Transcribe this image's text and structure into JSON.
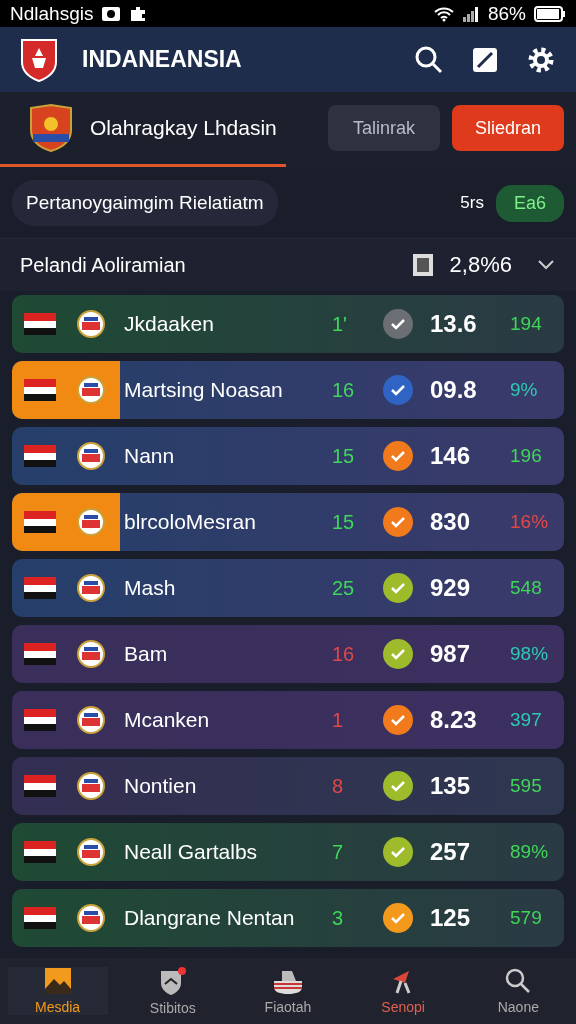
{
  "status_bar": {
    "carrier": "Ndlahsgis",
    "battery": "86%"
  },
  "header": {
    "title": "INDANEANSIA"
  },
  "team_bar": {
    "name": "Olahragkay Lhdasin",
    "buttons": [
      {
        "label": "Talinrak",
        "selected": false
      },
      {
        "label": "Sliedran",
        "selected": true
      }
    ]
  },
  "filter": {
    "label": "Pertanoygaimgim Rielatiatm",
    "count": "5rs",
    "badge": "Ea6"
  },
  "section": {
    "title": "Pelandi Aoliramian",
    "value": "2,8%6",
    "expanded": false
  },
  "rows": [
    {
      "name": "Jkdaaken",
      "kind": "green",
      "highlighted": false,
      "count": {
        "text": "1'",
        "color": "#3fd65a"
      },
      "check": {
        "color": "#6b6e73"
      },
      "score": "13.6",
      "percent": {
        "text": "194",
        "color": "#3fd65a"
      }
    },
    {
      "name": "Martsing Noasan",
      "kind": "blue",
      "highlighted": true,
      "count": {
        "text": "16",
        "color": "#3fd65a"
      },
      "check": {
        "color": "#2f64c4"
      },
      "score": "09.8",
      "percent": {
        "text": "9%",
        "color": "#2ec9b4"
      }
    },
    {
      "name": "Nann",
      "kind": "blue",
      "highlighted": false,
      "count": {
        "text": "15",
        "color": "#3fd65a"
      },
      "check": {
        "color": "#f07a1c"
      },
      "score": "146",
      "percent": {
        "text": "196",
        "color": "#3fd65a"
      }
    },
    {
      "name": "blrcoloMesran",
      "kind": "blue",
      "highlighted": true,
      "count": {
        "text": "15",
        "color": "#3fd65a"
      },
      "check": {
        "color": "#f07a1c"
      },
      "score": "830",
      "percent": {
        "text": "16%",
        "color": "#e04848"
      }
    },
    {
      "name": "Mash",
      "kind": "blue",
      "highlighted": false,
      "count": {
        "text": "25",
        "color": "#3fd65a"
      },
      "check": {
        "color": "#9dbb2a"
      },
      "score": "929",
      "percent": {
        "text": "548",
        "color": "#3fd65a"
      }
    },
    {
      "name": "Bam",
      "kind": "purple",
      "highlighted": false,
      "count": {
        "text": "16",
        "color": "#e04848"
      },
      "check": {
        "color": "#9dbb2a"
      },
      "score": "987",
      "percent": {
        "text": "98%",
        "color": "#2ec9b4"
      }
    },
    {
      "name": "Mcanken",
      "kind": "purple",
      "highlighted": false,
      "count": {
        "text": "1",
        "color": "#e04848"
      },
      "check": {
        "color": "#f07a1c"
      },
      "score": "8.23",
      "percent": {
        "text": "397",
        "color": "#2ec9b4"
      }
    },
    {
      "name": "Nontien",
      "kind": "slate",
      "highlighted": false,
      "count": {
        "text": "8",
        "color": "#e04848"
      },
      "check": {
        "color": "#9dbb2a"
      },
      "score": "135",
      "percent": {
        "text": "595",
        "color": "#3fd65a"
      }
    },
    {
      "name": "Neall Gartalbs",
      "kind": "green",
      "highlighted": false,
      "count": {
        "text": "7",
        "color": "#3fd65a"
      },
      "check": {
        "color": "#9dbb2a"
      },
      "score": "257",
      "percent": {
        "text": "89%",
        "color": "#3fd65a"
      }
    },
    {
      "name": "Dlangrane Nentan",
      "kind": "green",
      "highlighted": false,
      "count": {
        "text": "3",
        "color": "#3fd65a"
      },
      "check": {
        "color": "#f39a1c"
      },
      "score": "125",
      "percent": {
        "text": "579",
        "color": "#3fd65a"
      }
    }
  ],
  "nav": [
    {
      "label": "Mesdia",
      "kind": "normal",
      "selected": true
    },
    {
      "label": "Stibitos",
      "kind": "normal",
      "selected": false
    },
    {
      "label": "Fiaotah",
      "kind": "normal",
      "selected": false
    },
    {
      "label": "Senopi",
      "kind": "alert",
      "selected": false
    },
    {
      "label": "Naone",
      "kind": "normal",
      "selected": false
    }
  ]
}
